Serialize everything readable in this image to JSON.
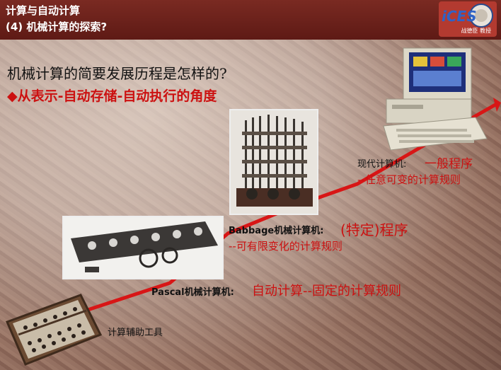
{
  "header": {
    "line1": "计算与自动计算",
    "line2": "(4) 机械计算的探索?",
    "logo_text": "iCES",
    "logo_caption": "战德臣 教授"
  },
  "question": "机械计算的简要发展历程是怎样的?",
  "subpoint": "◆从表示-自动存储-自动执行的角度",
  "stages": {
    "modern": {
      "name": "现代计算机:",
      "desc1": "一般程序",
      "desc2": "--任意可变的计算规则"
    },
    "babbage": {
      "name": "Babbage机械计算机:",
      "desc1": "(特定)程序",
      "desc2": "--可有限变化的计算规则"
    },
    "pascal": {
      "name": "Pascal机械计算机:",
      "desc1": "自动计算--固定的计算规则"
    },
    "abacus": {
      "name": "计算辅助工具"
    }
  },
  "colors": {
    "header_bg": "#6e221c",
    "accent_red": "#cc1111"
  }
}
